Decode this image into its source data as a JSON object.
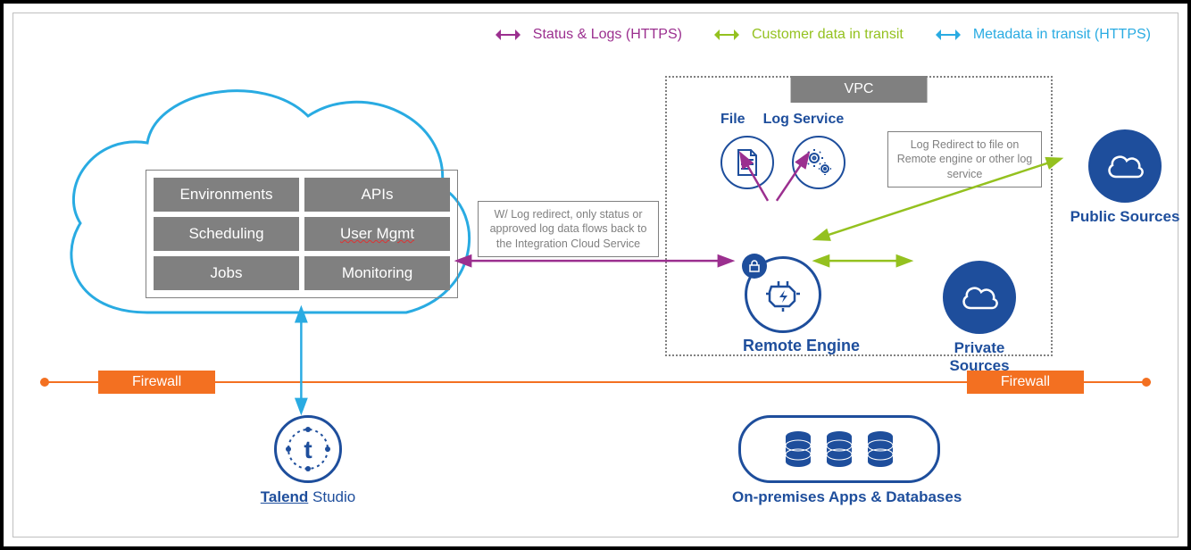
{
  "legend": {
    "status_logs": "Status & Logs (HTTPS)",
    "customer_data": "Customer data in transit",
    "metadata": "Metadata in transit (HTTPS)"
  },
  "cloud": {
    "modules": [
      "Environments",
      "APIs",
      "Scheduling",
      "User Mgmt",
      "Jobs",
      "Monitoring"
    ]
  },
  "vpc": {
    "title": "VPC",
    "file_label": "File",
    "log_service_label": "Log Service",
    "remote_engine_label": "Remote Engine",
    "private_sources_label": "Private Sources"
  },
  "public_sources_label": "Public Sources",
  "callouts": {
    "log_redirect_note": "W/ Log redirect, only status or approved log data flows back to the Integration Cloud Service",
    "log_redirect_box": "Log Redirect to file on Remote engine or other log service"
  },
  "firewall_label": "Firewall",
  "studio": {
    "brand": "Talend",
    "product": " Studio"
  },
  "onprem_label": "On-premises Apps & Databases",
  "colors": {
    "purple": "#9b2f8f",
    "green": "#94c11f",
    "cyan": "#29abe2",
    "orange": "#f37021",
    "navy": "#1e4e9c",
    "grey": "#808080"
  }
}
